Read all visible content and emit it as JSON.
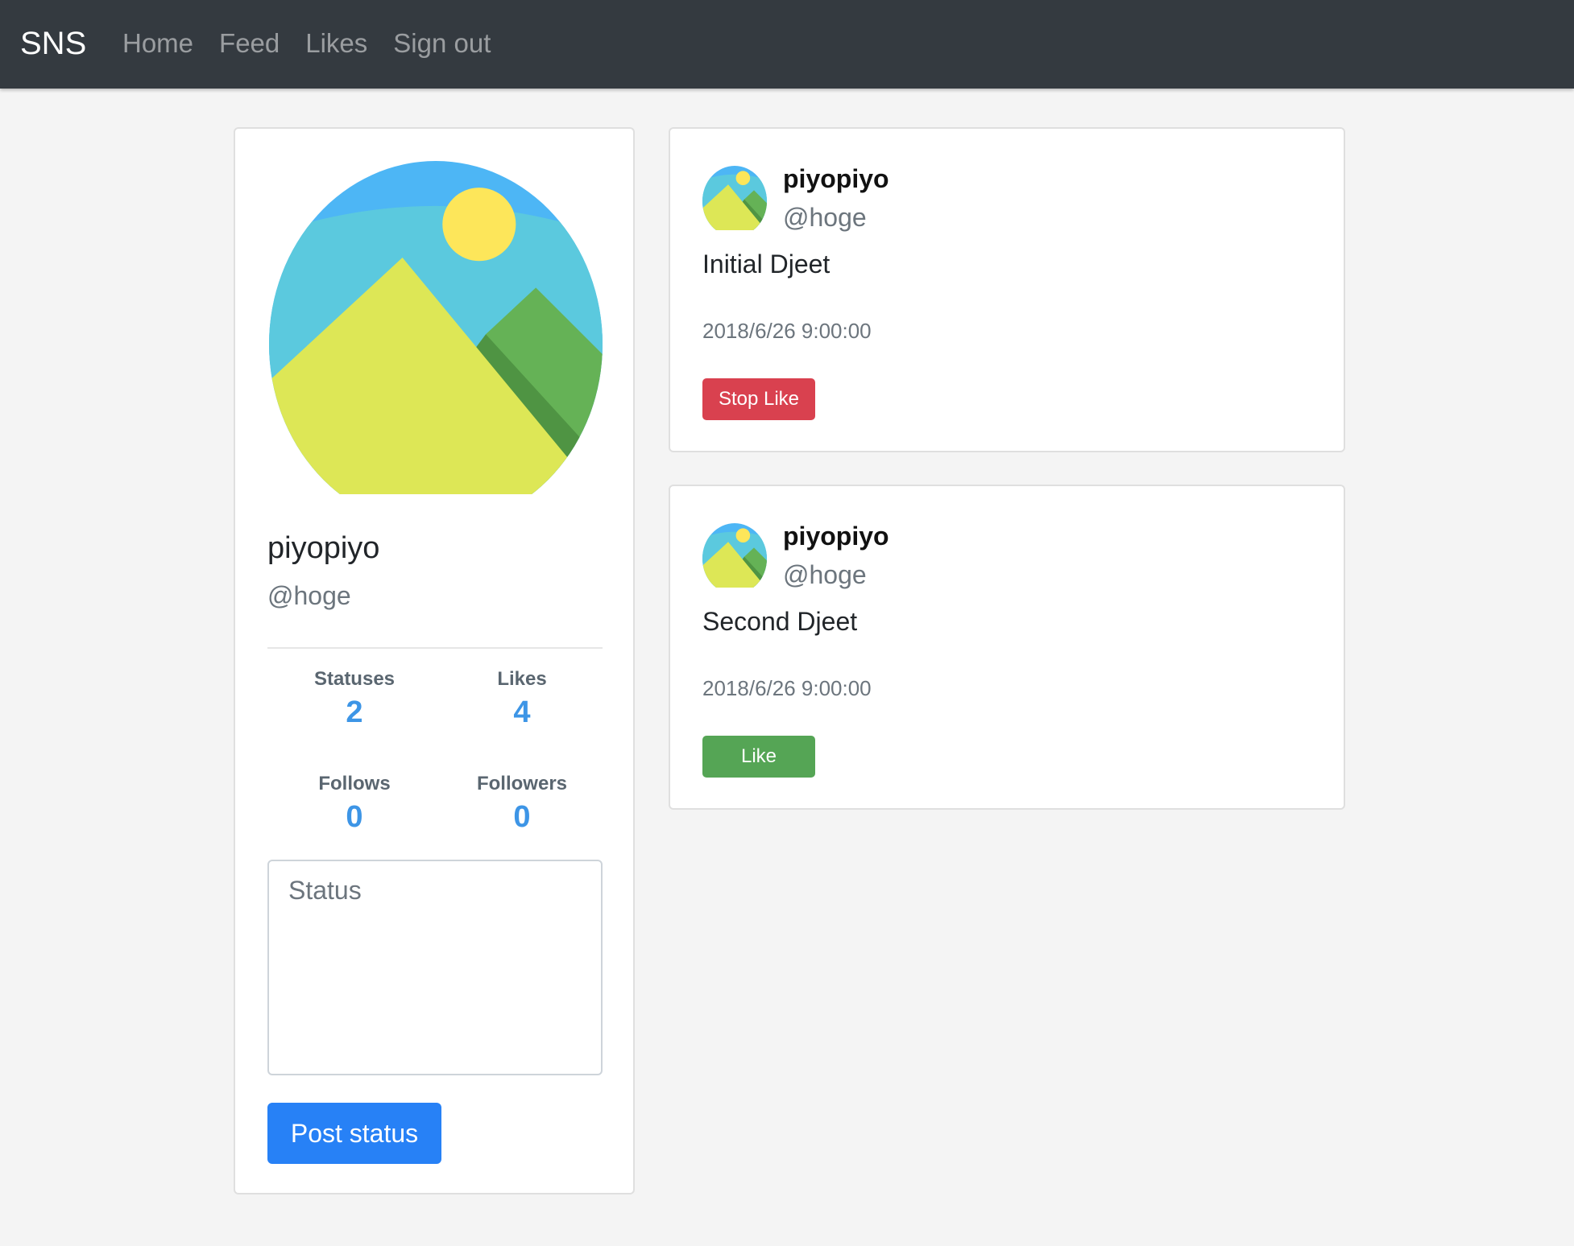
{
  "navbar": {
    "brand": "SNS",
    "links": [
      "Home",
      "Feed",
      "Likes",
      "Sign out"
    ]
  },
  "profile": {
    "name": "piyopiyo",
    "handle": "@hoge",
    "avatar_icon": "landscape-avatar-icon",
    "stats": [
      {
        "label": "Statuses",
        "value": "2"
      },
      {
        "label": "Likes",
        "value": "4"
      },
      {
        "label": "Follows",
        "value": "0"
      },
      {
        "label": "Followers",
        "value": "0"
      }
    ],
    "status_placeholder": "Status",
    "status_value": "",
    "post_button_label": "Post status"
  },
  "feed": [
    {
      "name": "piyopiyo",
      "handle": "@hoge",
      "text": "Initial Djeet",
      "date": "2018/6/26 9:00:00",
      "button_label": "Stop Like",
      "button_color": "#d9414f"
    },
    {
      "name": "piyopiyo",
      "handle": "@hoge",
      "text": "Second Djeet",
      "date": "2018/6/26 9:00:00",
      "button_label": "Like",
      "button_color": "#55a555"
    }
  ],
  "colors": {
    "navbar_bg": "#343a40",
    "accent_blue": "#2781f6",
    "stat_blue": "#3d95e6",
    "danger": "#d9414f",
    "success": "#55a555"
  }
}
